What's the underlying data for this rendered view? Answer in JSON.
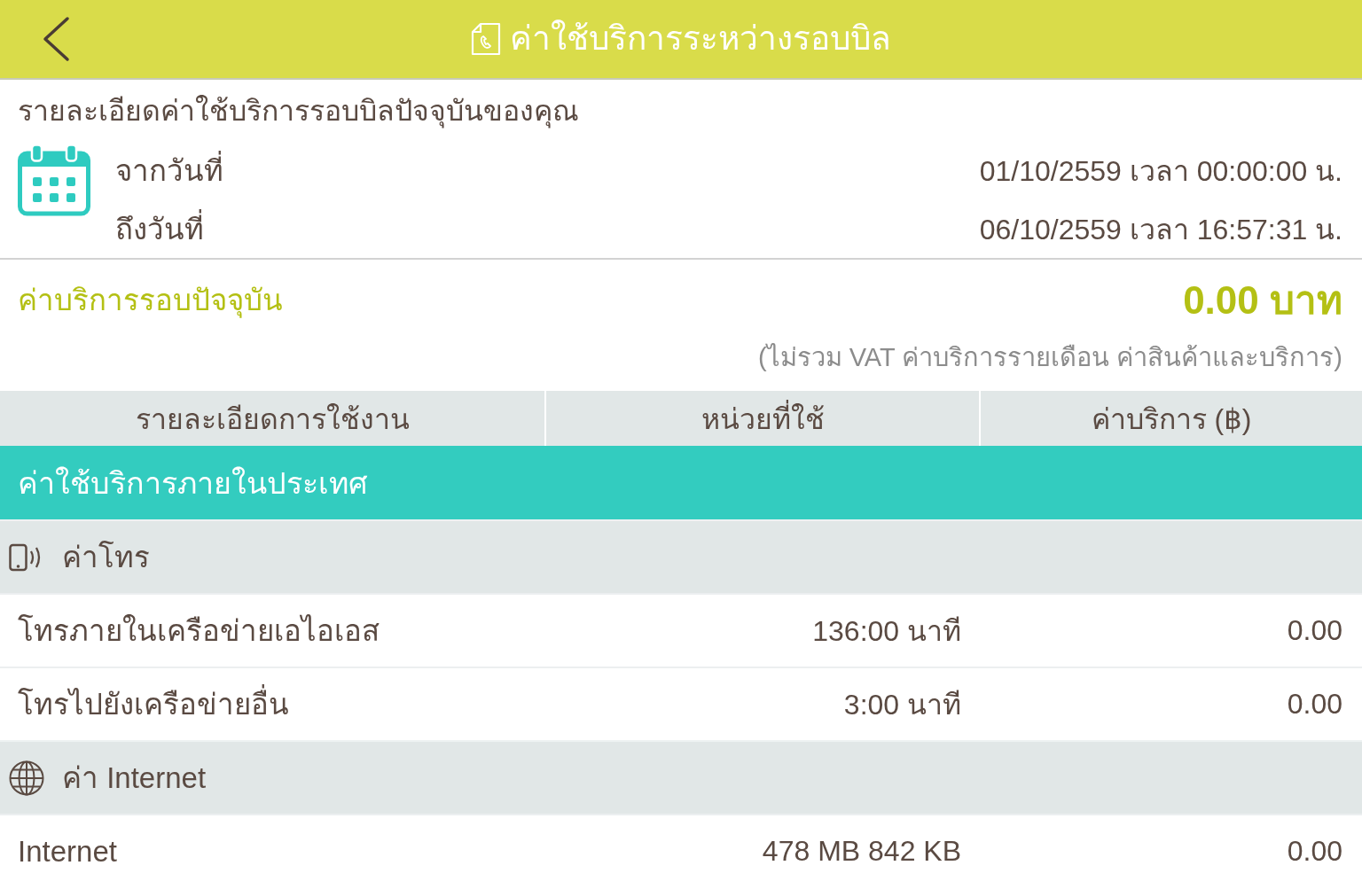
{
  "header": {
    "title": "ค่าใช้บริการระหว่างรอบบิล"
  },
  "period": {
    "heading": "รายละเอียดค่าใช้บริการรอบบิลปัจจุบันของคุณ",
    "rows": [
      {
        "label": "จากวันที่",
        "value": "01/10/2559 เวลา 00:00:00 น."
      },
      {
        "label": "ถึงวันที่",
        "value": "06/10/2559 เวลา 16:57:31 น."
      }
    ]
  },
  "summary": {
    "label": "ค่าบริการรอบปัจจุบัน",
    "amount": "0.00 บาท",
    "note": "(ไม่รวม VAT ค่าบริการรายเดือน ค่าสินค้าและบริการ)"
  },
  "table": {
    "columns": [
      "รายละเอียดการใช้งาน",
      "หน่วยที่ใช้",
      "ค่าบริการ (฿)"
    ],
    "sections": [
      {
        "title": "ค่าใช้บริการภายในประเทศ",
        "groups": [
          {
            "kind": "call",
            "title": "ค่าโทร",
            "rows": [
              {
                "item": "โทรภายในเครือข่ายเอไอเอส",
                "usage": "136:00 นาที",
                "charge": "0.00"
              },
              {
                "item": "โทรไปยังเครือข่ายอื่น",
                "usage": "3:00 นาที",
                "charge": "0.00"
              }
            ]
          },
          {
            "kind": "internet",
            "title": "ค่า Internet",
            "rows": [
              {
                "item": "Internet",
                "usage": "478 MB 842 KB",
                "charge": "0.00"
              }
            ]
          }
        ]
      }
    ]
  }
}
